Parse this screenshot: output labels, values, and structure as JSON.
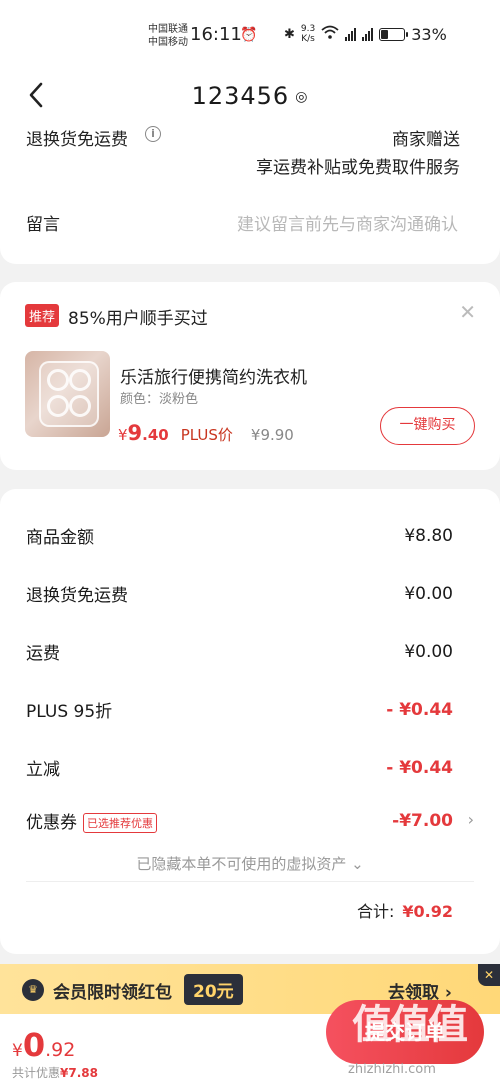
{
  "status_bar": {
    "carrier1": "中国联通",
    "carrier2": "中国移动",
    "time": "16:11",
    "speed_value": "9.3",
    "speed_unit": "K/s",
    "sig1_label": "5G",
    "sig2_label": "4G",
    "battery": "33%",
    "battery_level": 0.33
  },
  "nav": {
    "title": "123456"
  },
  "card1": {
    "free_return_label": "退换货免运费",
    "merchant_gift": "商家赠送",
    "subsidy": "享运费补贴或免费取件服务",
    "message_label": "留言",
    "message_placeholder": "建议留言前先与商家沟通确认"
  },
  "recommend": {
    "tag": "推荐",
    "title": "85%用户顺手买过",
    "product_name": "乐活旅行便携简约洗衣机",
    "color": "颜色：淡粉色",
    "price_yen": "¥",
    "price_int": "9",
    "price_dec": ".40",
    "plus_label": "PLUS价",
    "orig_price": "¥9.90",
    "buy_button": "一键购买"
  },
  "summary": {
    "rows": [
      {
        "label": "商品金额",
        "value": "¥8.80"
      },
      {
        "label": "退换货免运费",
        "value": "¥0.00"
      },
      {
        "label": "运费",
        "value": "¥0.00"
      },
      {
        "label": "PLUS 95折",
        "value": "- ¥0.44"
      },
      {
        "label": "立减",
        "value": "- ¥0.44"
      },
      {
        "label": "优惠券",
        "value": "-¥7.00",
        "tag": "已选推荐优惠"
      }
    ],
    "hidden_assets": "已隐藏本单不可使用的虚拟资产",
    "total_label": "合计:",
    "total_value": "¥0.92"
  },
  "banner": {
    "text": "会员限时领红包",
    "amount": "20元",
    "claim": "去领取",
    "close": "✕"
  },
  "footer": {
    "yen": "¥",
    "pay_int": "0",
    "pay_dec": ".92",
    "discount_label": "共计优惠",
    "discount_value": "¥7.88",
    "submit": "提交订单"
  },
  "watermark": {
    "logo": "值值值",
    "url": "zhizhizhi.com"
  },
  "colors": {
    "accent": "#e4393c",
    "banner_bg": "#ffdd80",
    "dark": "#2b2f3a"
  }
}
